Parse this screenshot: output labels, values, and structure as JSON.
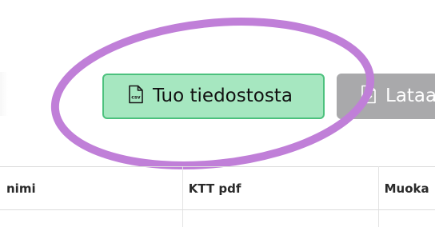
{
  "toolbar": {
    "import_button": {
      "label": "Tuo tiedostosta",
      "icon": "csv-file-icon",
      "icon_text": "csv",
      "color": "#a6e7c0",
      "border_color": "#4cc17d"
    },
    "download_button": {
      "label": "Lataa",
      "icon": "download-file-icon",
      "color": "#a9a9ab"
    }
  },
  "annotation": {
    "shape": "ellipse",
    "color": "#c07fd8"
  },
  "table": {
    "headers": [
      "nimi",
      "KTT pdf",
      "Muoka"
    ]
  }
}
